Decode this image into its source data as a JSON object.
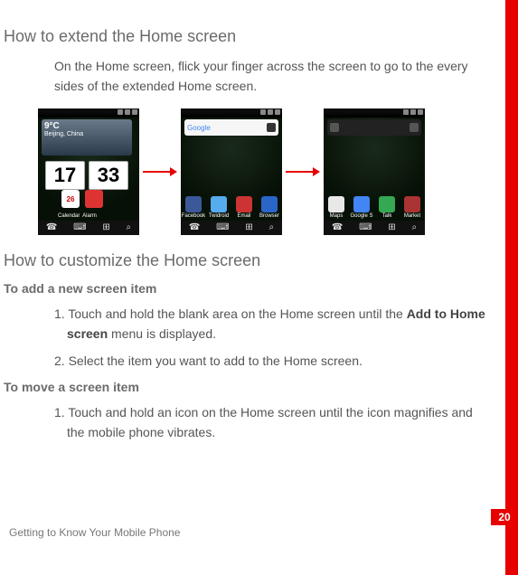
{
  "page_number": "20",
  "footer": "Getting to Know Your Mobile Phone",
  "section1": {
    "title": "How to extend the Home screen",
    "intro": "On the Home screen, flick your finger across the screen to go to the every sides of the extended Home screen."
  },
  "screens": {
    "screen1": {
      "temp_label": "9°C",
      "city_label": "Beijing, China",
      "clock_h": "17",
      "clock_m": "33",
      "icon_cal_label": "Calendar",
      "icon_cal_text": "26",
      "icon_alarm_label": "Alarm"
    },
    "screen2": {
      "search_brand": "Google",
      "apps": [
        {
          "label": "Facebook",
          "color": "#3b5998"
        },
        {
          "label": "Twidroid",
          "color": "#55acee"
        },
        {
          "label": "Email",
          "color": "#c33"
        },
        {
          "label": "Browser",
          "color": "#2a66c8"
        }
      ]
    },
    "screen3": {
      "apps": [
        {
          "label": "Maps",
          "color": "#e8e8e8"
        },
        {
          "label": "Google S",
          "color": "#4285f4"
        },
        {
          "label": "Talk",
          "color": "#34a853"
        },
        {
          "label": "Market",
          "color": "#a33"
        }
      ]
    },
    "nav_glyphs": [
      "☎",
      "⌨",
      "⊞",
      "⌕"
    ]
  },
  "section2": {
    "title": "How to customize the Home screen",
    "sub1": "To add a new screen item",
    "sub1_steps": {
      "s1_pre": "Touch and hold the blank area on the Home screen until the ",
      "s1_bold": "Add to Home screen",
      "s1_post": " menu is displayed.",
      "s2": "Select the item you want to add to the Home screen."
    },
    "sub2": "To move a screen item",
    "sub2_steps": {
      "s1": "Touch and hold an icon on the Home screen until the icon magnifies and the mobile phone vibrates."
    }
  }
}
